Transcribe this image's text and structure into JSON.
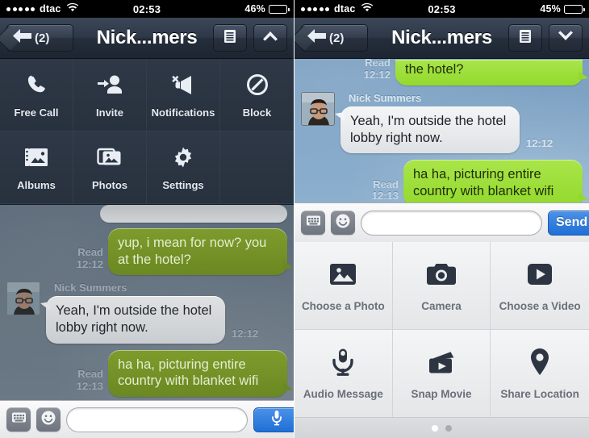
{
  "left": {
    "status": {
      "carrier": "dtac",
      "signal_dots": 5,
      "wifi_icon": "wifi-icon",
      "time": "02:53",
      "battery_pct": "46%",
      "battery_level": 46
    },
    "nav": {
      "back_label": "(2)",
      "back_icon": "back-arrow-icon",
      "title": "Nick...mers",
      "menu_icon": "list-menu-icon",
      "toggle_icon": "chevron-up-icon"
    },
    "actions": [
      {
        "label": "Free Call",
        "icon": "phone-icon"
      },
      {
        "label": "Invite",
        "icon": "add-person-icon"
      },
      {
        "label": "Notifications",
        "icon": "muted-megaphone-icon"
      },
      {
        "label": "Block",
        "icon": "block-icon"
      },
      {
        "label": "Albums",
        "icon": "albums-icon"
      },
      {
        "label": "Photos",
        "icon": "photos-icon"
      },
      {
        "label": "Settings",
        "icon": "gear-icon"
      }
    ],
    "messages": [
      {
        "dir": "out",
        "status": "Read",
        "time": "12:12",
        "text": "yup, i mean for now? you at the hotel?"
      },
      {
        "dir": "in",
        "sender": "Nick Summers",
        "time": "12:12",
        "text": "Yeah, I'm outside the hotel lobby right now."
      },
      {
        "dir": "out",
        "status": "Read",
        "time": "12:13",
        "text": "ha ha, picturing entire country with blanket wifi"
      }
    ],
    "input": {
      "keyboard_icon": "keyboard-icon",
      "emoji_icon": "smiley-icon",
      "value": "",
      "placeholder": "",
      "mic_icon": "microphone-icon"
    }
  },
  "right": {
    "status": {
      "carrier": "dtac",
      "signal_dots": 5,
      "wifi_icon": "wifi-icon",
      "time": "02:53",
      "battery_pct": "45%",
      "battery_level": 45
    },
    "nav": {
      "back_label": "(2)",
      "back_icon": "back-arrow-icon",
      "title": "Nick...mers",
      "menu_icon": "list-menu-icon",
      "toggle_icon": "chevron-down-icon"
    },
    "messages": [
      {
        "dir": "out",
        "status": "Read",
        "time": "12:12",
        "text": "the hotel?"
      },
      {
        "dir": "in",
        "sender": "Nick Summers",
        "time": "12:12",
        "text": "Yeah, I'm outside the hotel lobby right now."
      },
      {
        "dir": "out",
        "status": "Read",
        "time": "12:13",
        "text": "ha ha, picturing entire country with blanket wifi"
      }
    ],
    "input": {
      "keyboard_icon": "keyboard-icon",
      "emoji_icon": "smiley-icon",
      "value": "",
      "placeholder": "",
      "send_label": "Send"
    },
    "attachments": [
      {
        "label": "Choose a Photo",
        "icon": "photo-icon"
      },
      {
        "label": "Camera",
        "icon": "camera-icon"
      },
      {
        "label": "Choose a Video",
        "icon": "video-play-icon"
      },
      {
        "label": "Audio Message",
        "icon": "microphone-icon"
      },
      {
        "label": "Snap Movie",
        "icon": "clapperboard-icon"
      },
      {
        "label": "Share Location",
        "icon": "location-pin-icon"
      }
    ],
    "pager": {
      "pages": 2,
      "active": 1
    }
  },
  "colors": {
    "navbar": "#2b3443",
    "accent_blue": "#2272d8",
    "bubble_out_green": "#93d92d",
    "bubble_in_gray": "#e8eaec",
    "wallpaper_left": "#61707e",
    "wallpaper_right": "#7ea4c5",
    "panel_dark": "#2b3443",
    "panel_light": "#e9eaec"
  }
}
